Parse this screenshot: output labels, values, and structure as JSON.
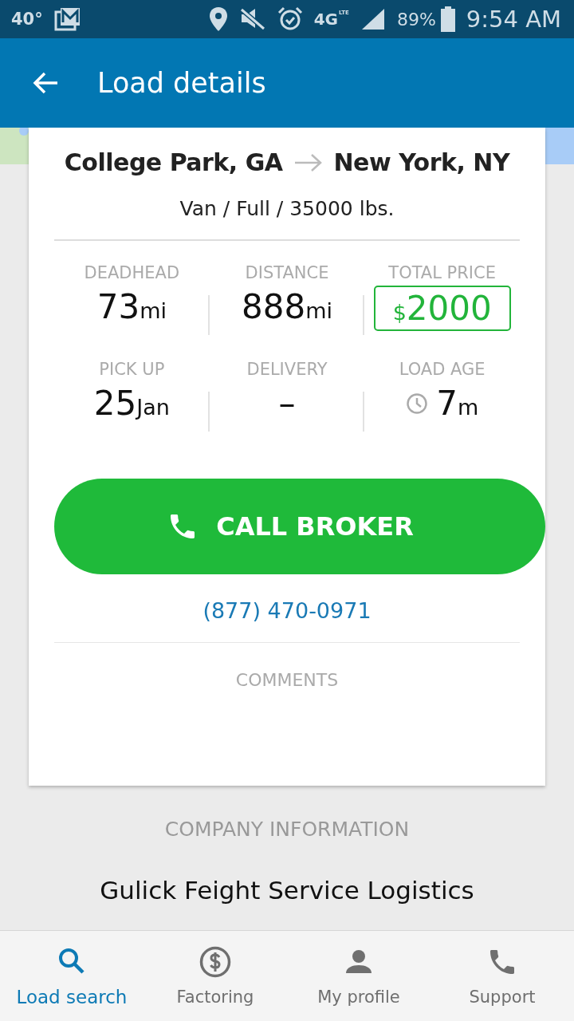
{
  "status_bar": {
    "temperature": "40°",
    "network": "4G",
    "network_sub": "LTE",
    "battery_percent": "89%",
    "time": "9:54 AM"
  },
  "app_bar": {
    "title": "Load details"
  },
  "load": {
    "origin": "College Park, GA",
    "destination": "New York, NY",
    "equipment": "Van / Full / 35000 lbs.",
    "stats": [
      {
        "kind": "plain",
        "label": "DEADHEAD",
        "value": "73",
        "unit": "mi"
      },
      {
        "kind": "plain",
        "label": "DISTANCE",
        "value": "888",
        "unit": "mi"
      },
      {
        "kind": "price",
        "label": "TOTAL PRICE",
        "currency": "$",
        "value": "2000"
      },
      {
        "kind": "plain",
        "label": "PICK UP",
        "value": "25",
        "unit": "Jan"
      },
      {
        "kind": "plain",
        "label": "DELIVERY",
        "value": "–"
      },
      {
        "kind": "age",
        "label": "LOAD AGE",
        "value": "7",
        "unit": "m"
      }
    ],
    "call_button": "CALL BROKER",
    "phone": "(877) 470-0971",
    "comments_label": "COMMENTS"
  },
  "company": {
    "heading": "COMPANY INFORMATION",
    "name": "Gulick Feight Service Logistics"
  },
  "bottom_nav": [
    {
      "label": "Load search",
      "kind": "search",
      "selected": true
    },
    {
      "label": "Factoring",
      "kind": "factoring",
      "selected": false
    },
    {
      "label": "My profile",
      "kind": "profile",
      "selected": false
    },
    {
      "label": "Support",
      "kind": "support",
      "selected": false
    }
  ]
}
